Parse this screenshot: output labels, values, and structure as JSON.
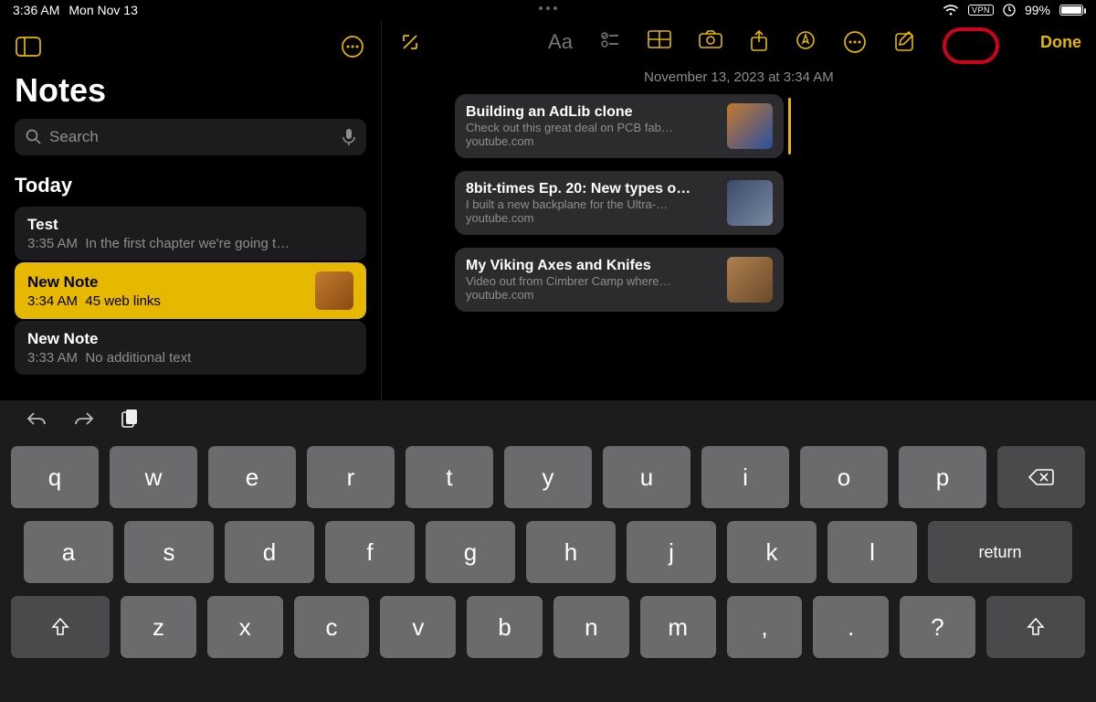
{
  "statusbar": {
    "time": "3:36 AM",
    "date": "Mon Nov 13",
    "vpn": "VPN",
    "battery_pct": "99%"
  },
  "sidebar": {
    "title": "Notes",
    "search_placeholder": "Search",
    "section": "Today",
    "items": [
      {
        "title": "Test",
        "time": "3:35 AM",
        "preview": "In the first chapter we're going t…"
      },
      {
        "title": "New Note",
        "time": "3:34 AM",
        "preview": "45 web links"
      },
      {
        "title": "New Note",
        "time": "3:33 AM",
        "preview": "No additional text"
      }
    ]
  },
  "editor": {
    "date": "November 13, 2023 at 3:34 AM",
    "done": "Done",
    "links": [
      {
        "title": "Building an AdLib clone",
        "desc": "Check out this great deal on PCB fab…",
        "domain": "youtube.com",
        "thumb": "linear-gradient(135deg,#c47a2e,#2a4fa0)"
      },
      {
        "title": "8bit-times Ep. 20: New types o…",
        "desc": "I built a new backplane for the Ultra-…",
        "domain": "youtube.com",
        "thumb": "linear-gradient(135deg,#3a4a6a,#7a8aa0)"
      },
      {
        "title": "My Viking Axes and Knifes",
        "desc": "Video out from Cimbrer Camp where…",
        "domain": "youtube.com",
        "thumb": "linear-gradient(135deg,#b08050,#6a4a2a)"
      }
    ]
  },
  "keyboard": {
    "return": "return",
    "rows": [
      [
        "q",
        "w",
        "e",
        "r",
        "t",
        "y",
        "u",
        "i",
        "o",
        "p"
      ],
      [
        "a",
        "s",
        "d",
        "f",
        "g",
        "h",
        "j",
        "k",
        "l"
      ],
      [
        "z",
        "x",
        "c",
        "v",
        "b",
        "n",
        "m",
        ",",
        ".",
        "?"
      ]
    ]
  }
}
